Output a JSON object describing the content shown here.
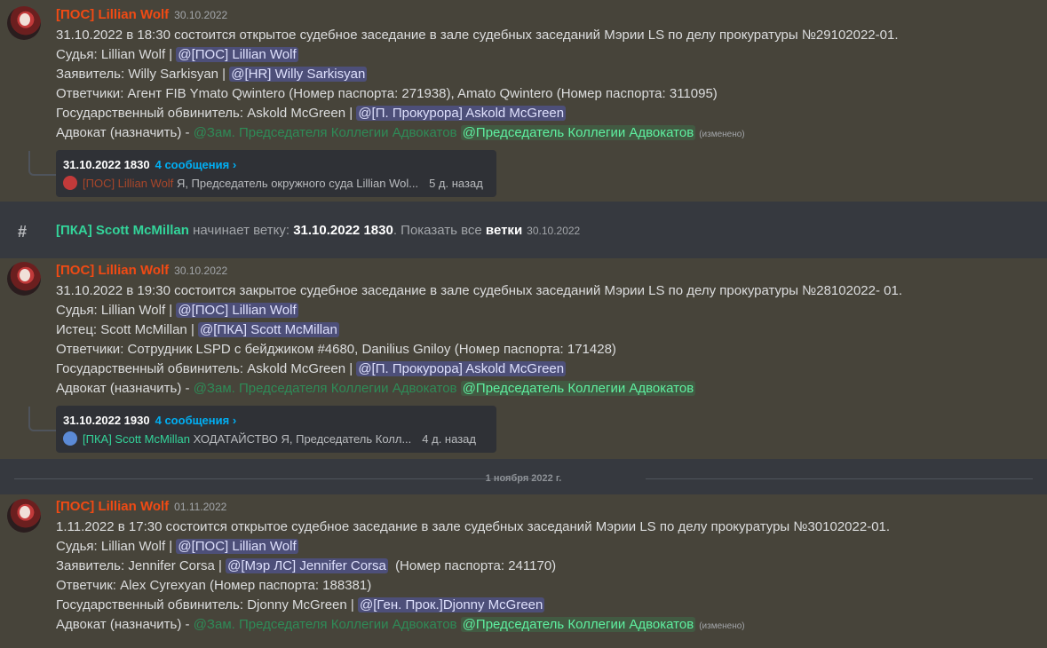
{
  "messages": [
    {
      "author": "[ПОС] Lillian Wolf",
      "timestamp": "30.10.2022",
      "lines": [
        {
          "text": "31.10.2022 в 18:30 состоится открытое судебное заседание в зале судебных заседаний Мэрии LS по делу прокуратуры №29102022-01."
        },
        {
          "text": "Судья: Lillian Wolf |",
          "mention": "@[ПОС] Lillian Wolf"
        },
        {
          "text": "Заявитель: Willy Sarkisyan |",
          "mention": "@[HR] Willy Sarkisyan"
        },
        {
          "text": "Ответчики: Агент FIB Ymato Qwintero (Номер паспорта: 271938), Amato Qwintero (Номер паспорта: 311095)"
        },
        {
          "text": "Государственный обвинитель: Askold McGreen |",
          "mention": "@[П. Прокурора] Askold McGreen"
        },
        {
          "text": "Адвокат (назначить) -",
          "role1": "@Зам. Председателя Коллегии Адвокатов",
          "role2": "@Председатель Коллегии Адвокатов",
          "edited": "(изменено)"
        }
      ],
      "thread": {
        "title": "31.10.2022 1830",
        "count": "4 сообщения ›",
        "last_author": "[ПОС] Lillian Wolf",
        "last_text": "Я, Председатель окружного суда Lillian Wol...",
        "ago": "5 д. назад"
      }
    },
    {
      "author": "[ПОС] Lillian Wolf",
      "timestamp": "30.10.2022",
      "lines": [
        {
          "text": "31.10.2022 в 19:30 состоится закрытое судебное заседание в зале судебных заседаний Мэрии LS по делу прокуратуры №28102022- 01."
        },
        {
          "text": "Судья: Lillian Wolf |",
          "mention": "@[ПОС] Lillian Wolf"
        },
        {
          "text": "Истец: Scott McMillan |",
          "mention": "@[ПКА] Scott McMillan"
        },
        {
          "text": "Ответчики: Сотрудник LSPD с бейджиком #4680, Danilius Gniloy (Номер паспорта: 171428)"
        },
        {
          "text": "Государственный обвинитель: Askold McGreen |",
          "mention": "@[П. Прокурора] Askold McGreen"
        },
        {
          "text": "Адвокат (назначить) -",
          "role1": "@Зам. Председателя Коллегии Адвокатов",
          "role2": "@Председатель Коллегии Адвокатов"
        }
      ],
      "thread": {
        "title": "31.10.2022 1930",
        "count": "4 сообщения ›",
        "last_author": "[ПКА] Scott McMillan",
        "last_text": "ХОДАТАЙСТВО  Я, Председатель Колл...",
        "ago": "4 д. назад"
      }
    },
    {
      "author": "[ПОС] Lillian Wolf",
      "timestamp": "01.11.2022",
      "lines": [
        {
          "text": "1.11.2022 в 17:30 состоится открытое судебное заседание в зале судебных заседаний Мэрии LS по делу прокуратуры №30102022-01."
        },
        {
          "text": "Судья: Lillian Wolf |",
          "mention": "@[ПОС] Lillian Wolf"
        },
        {
          "text": "Заявитель: Jennifer Corsa |",
          "mention": "@[Мэр ЛС] Jennifer Corsa",
          "after": "(Номер паспорта: 241170)"
        },
        {
          "text": "Ответчик: Alex Cyrexyan (Номер паспорта: 188381)"
        },
        {
          "text": "Государственный обвинитель: Djonny McGreen |",
          "mention": "@[Ген. Прок.]Djonny McGreen"
        },
        {
          "text": "Адвокат (назначить) -",
          "role1": "@Зам. Председателя Коллегии Адвокатов",
          "role2": "@Председатель Коллегии Адвокатов",
          "edited": "(изменено)"
        }
      ]
    }
  ],
  "system": {
    "icon": "thread-icon",
    "who": "[ПКА] Scott McMillan",
    "action": "начинает ветку:",
    "thread_name": "31.10.2022 1830",
    "show_all_prefix": ". Показать все",
    "show_all_link": "ветки",
    "timestamp": "30.10.2022"
  },
  "date_divider": "1 ноября 2022 г.",
  "colors": {
    "author": "#f04a14",
    "mention_bg": "#4b4f8c",
    "role_green": "#2e8b57",
    "role_mint": "#5ef0a0",
    "thread_link": "#00aff4",
    "highlight_bg": "#47443a"
  }
}
